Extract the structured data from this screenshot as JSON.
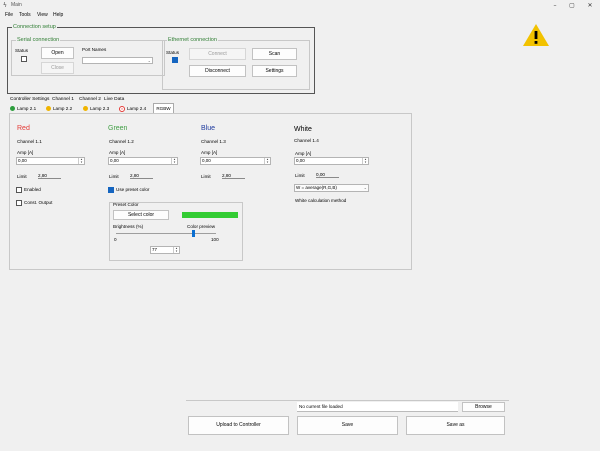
{
  "window": {
    "title": "Main",
    "app_icon": "app-icon",
    "controls": [
      "minimize-icon",
      "maximize-icon",
      "close-icon"
    ]
  },
  "menu": [
    "File",
    "Tools",
    "View",
    "Help"
  ],
  "connection_setup": {
    "title": "Connection setup",
    "serial": {
      "title": "Serial connection",
      "status_label": "Status",
      "open_label": "Open",
      "close_label": "Close",
      "port_names_label": "Port Names",
      "port_value": ""
    },
    "ethernet": {
      "title": "Ethernet connection",
      "status_label": "Status",
      "connect_label": "Connect",
      "scan_label": "Scan",
      "disconnect_label": "Disconnect",
      "settings_label": "Settings"
    }
  },
  "warning_icon": "warning-icon",
  "tabs": [
    "Controller Settings",
    "Channel 1",
    "Channel 2",
    "Live Data"
  ],
  "lamp_tabs": [
    {
      "label": "Lamp 2.1",
      "icon": "status-green-icon"
    },
    {
      "label": "Lamp 2.2",
      "icon": "status-yellow-icon"
    },
    {
      "label": "Lamp 2.3",
      "icon": "status-yellow-icon"
    },
    {
      "label": "Lamp 2.4",
      "icon": "status-error-icon"
    },
    {
      "label": "RGBW",
      "icon": ""
    }
  ],
  "colors": {
    "red": "#e53935",
    "green": "#43a047",
    "blue": "#1e3a9e",
    "preset": "#33cc33",
    "warning": "#f2c200"
  },
  "channels": {
    "red": {
      "title": "Red",
      "channel": "Channel 1.1",
      "amp_label": "Amp [A]",
      "amp_value": "0,00",
      "limit_label": "Limit",
      "limit_value": "2,80",
      "enabled_label": "Enabled",
      "const_output_label": "Const. Output"
    },
    "green": {
      "title": "Green",
      "channel": "Channel 1.2",
      "amp_label": "Amp [A]",
      "amp_value": "0,00",
      "limit_label": "Limit",
      "limit_value": "2,80",
      "use_preset_label": "Use preset color"
    },
    "blue": {
      "title": "Blue",
      "channel": "Channel 1.3",
      "amp_label": "Amp [A]",
      "amp_value": "0,00",
      "limit_label": "Limit",
      "limit_value": "2,80"
    },
    "white": {
      "title": "White",
      "channel": "Channel 1.4",
      "amp_label": "Amp [A]",
      "amp_value": "0,00",
      "limit_label": "Limit",
      "limit_value": "0,00",
      "method_value": "W = average(R,G,B)",
      "method_label": "White calculation method"
    }
  },
  "preset_color": {
    "title": "Preset Color",
    "select_label": "Select color",
    "brightness_label": "Brightness (%)",
    "preview_label": "Color preview",
    "slider_min": "0",
    "slider_max": "100",
    "brightness_value": "77",
    "brightness_fraction": 0.77
  },
  "footer": {
    "file_status": "No current file loaded",
    "browse_label": "Browse",
    "upload_label": "Upload to Controller",
    "save_label": "Save",
    "save_as_label": "Save as"
  }
}
